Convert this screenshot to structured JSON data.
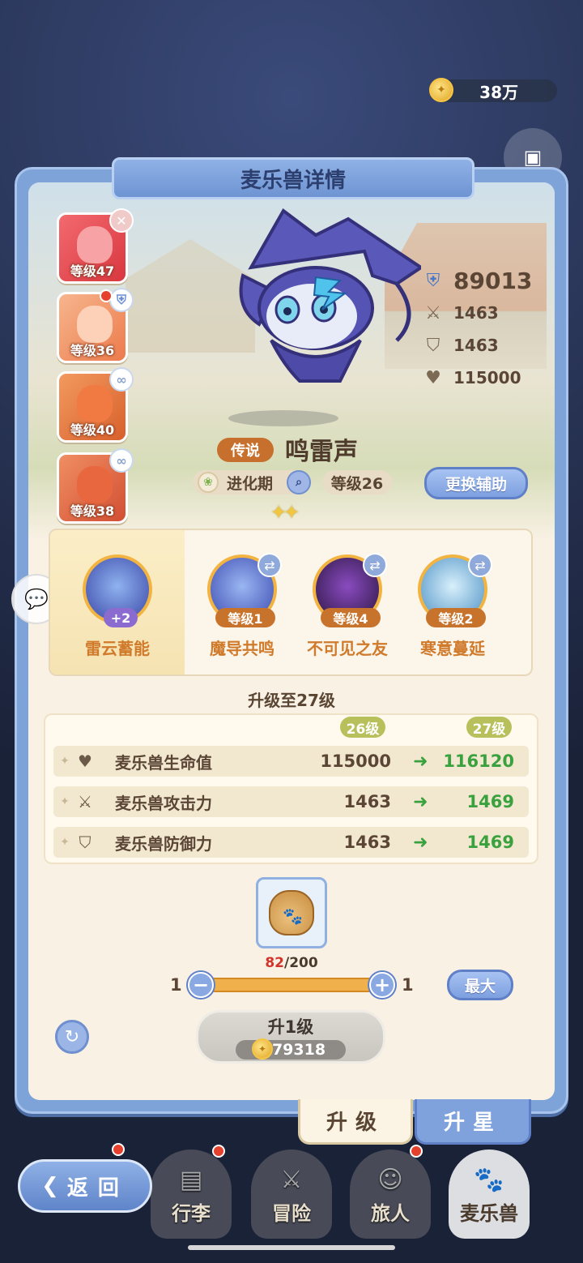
{
  "currency": {
    "amount": "38万",
    "icon": "coin-icon"
  },
  "title": "麦乐兽详情",
  "pet_list": [
    {
      "level_label": "等级47",
      "color": "#e04a4f",
      "badge": "×"
    },
    {
      "level_label": "等级36",
      "color": "#f08a5a",
      "badge": "shield"
    },
    {
      "level_label": "等级40",
      "color": "#e8703c",
      "badge": "∞"
    },
    {
      "level_label": "等级38",
      "color": "#e45c3a",
      "badge": "∞"
    }
  ],
  "stats": {
    "power": "89013",
    "attack": "1463",
    "defense": "1463",
    "hp": "115000"
  },
  "rarity": "传说",
  "pet_name": "鸣雷声",
  "evolution": "进化期",
  "level": "等级26",
  "switch_assist": "更换辅助",
  "star_count": 2,
  "skills": {
    "main": {
      "name": "雷云蓄能",
      "bonus": "+2"
    },
    "others": [
      {
        "name": "魔导共鸣",
        "level": "等级1",
        "color": "#4a5fbd"
      },
      {
        "name": "不可见之友",
        "level": "等级4",
        "color": "#5a2b7a"
      },
      {
        "name": "寒意蔓延",
        "level": "等级2",
        "color": "#7fb8d9"
      }
    ]
  },
  "upgrade": {
    "title": "升级至27级",
    "from_label": "26级",
    "to_label": "27级",
    "rows": [
      {
        "label": "麦乐兽生命值",
        "from": "115000",
        "to": "116120",
        "icon": "heart-icon"
      },
      {
        "label": "麦乐兽攻击力",
        "from": "1463",
        "to": "1469",
        "icon": "swords-icon"
      },
      {
        "label": "麦乐兽防御力",
        "from": "1463",
        "to": "1469",
        "icon": "shield-icon"
      }
    ]
  },
  "material": {
    "have": "82",
    "need": "/200"
  },
  "slider": {
    "min": "1",
    "max": "1",
    "max_button": "最大"
  },
  "upgrade_button": {
    "label": "升1级",
    "cost": "79318"
  },
  "tabs": {
    "levelup": "升级",
    "starup": "升星"
  },
  "back": "返回",
  "nav": [
    {
      "label": "行李",
      "icon": "chest-icon"
    },
    {
      "label": "冒险",
      "icon": "crossed-swords-icon"
    },
    {
      "label": "旅人",
      "icon": "traveler-icon"
    },
    {
      "label": "麦乐兽",
      "icon": "pet-icon"
    }
  ]
}
